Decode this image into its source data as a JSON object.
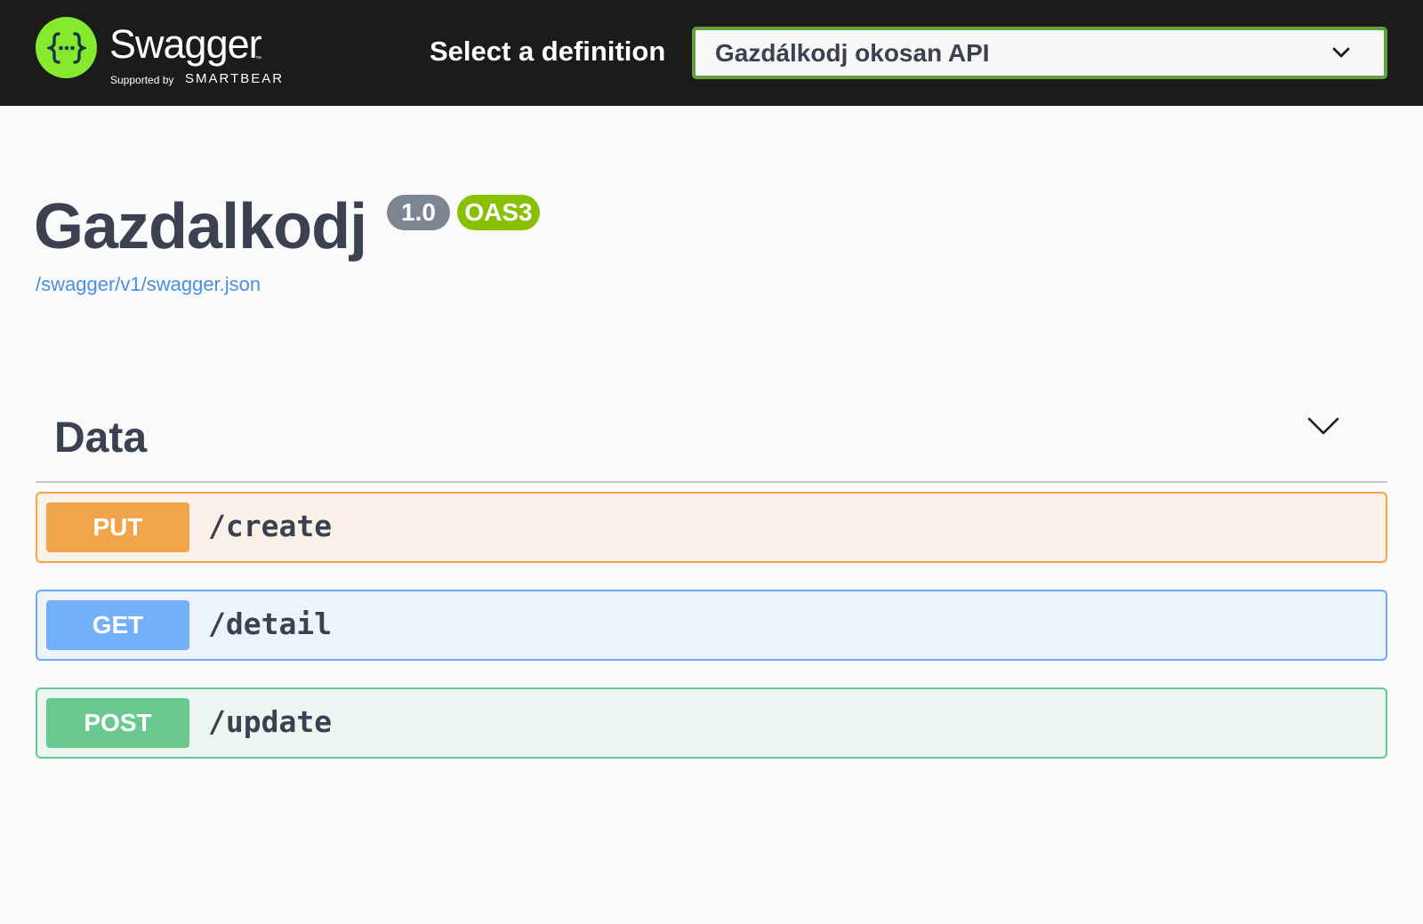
{
  "topbar": {
    "brand_name": "Swagger",
    "brand_tm": "™",
    "supported_by": "Supported by",
    "vendor": "SMARTBEAR",
    "select_label": "Select a definition",
    "selected_definition": "Gazdálkodj okosan API",
    "logo_icon": "swagger-braces-icon",
    "accent_color": "#85ea2d"
  },
  "info": {
    "title": "Gazdalkodj",
    "version": "1.0",
    "oas": "OAS3",
    "spec_url": "/swagger/v1/swagger.json"
  },
  "tag": {
    "name": "Data",
    "chevron_icon": "chevron-down-icon"
  },
  "operations": [
    {
      "method": "PUT",
      "path": "/create",
      "color": "#f0a54b"
    },
    {
      "method": "GET",
      "path": "/detail",
      "color": "#74b0f9"
    },
    {
      "method": "POST",
      "path": "/update",
      "color": "#6ac990"
    }
  ]
}
